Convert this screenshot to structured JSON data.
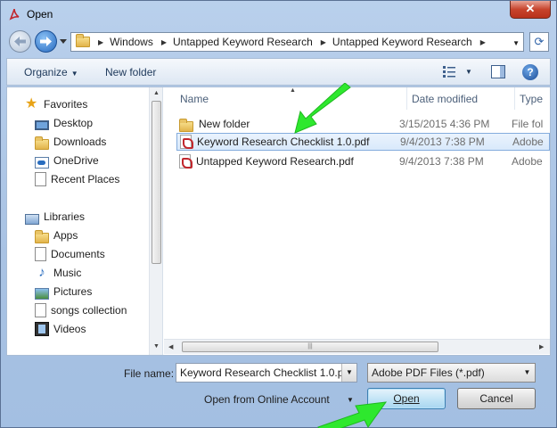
{
  "window": {
    "title": "Open",
    "close_label": "✕"
  },
  "address": {
    "crumbs": [
      "Windows",
      "Untapped Keyword Research",
      "Untapped Keyword Research"
    ]
  },
  "toolbar": {
    "organize_label": "Organize",
    "new_folder_label": "New folder"
  },
  "nav_pane": {
    "favorites_label": "Favorites",
    "favorites": [
      {
        "label": "Desktop",
        "icon": "desktop-icon"
      },
      {
        "label": "Downloads",
        "icon": "downloads-icon"
      },
      {
        "label": "OneDrive",
        "icon": "onedrive-icon"
      },
      {
        "label": "Recent Places",
        "icon": "recent-places-icon"
      }
    ],
    "libraries_label": "Libraries",
    "libraries": [
      {
        "label": "Apps",
        "icon": "folder-icon"
      },
      {
        "label": "Documents",
        "icon": "documents-icon"
      },
      {
        "label": "Music",
        "icon": "music-icon"
      },
      {
        "label": "Pictures",
        "icon": "pictures-icon"
      },
      {
        "label": "songs collection",
        "icon": "library-icon"
      },
      {
        "label": "Videos",
        "icon": "videos-icon"
      }
    ]
  },
  "file_list": {
    "columns": [
      "Name",
      "Date modified",
      "Type"
    ],
    "rows": [
      {
        "name": "New folder",
        "date": "3/15/2015 4:36 PM",
        "type": "File fol",
        "icon": "folder-icon",
        "selected": false
      },
      {
        "name": "Keyword Research Checklist 1.0.pdf",
        "date": "9/4/2013 7:38 PM",
        "type": "Adobe",
        "icon": "pdf-icon",
        "selected": true
      },
      {
        "name": "Untapped Keyword Research.pdf",
        "date": "9/4/2013 7:38 PM",
        "type": "Adobe",
        "icon": "pdf-icon",
        "selected": false
      }
    ]
  },
  "bottom": {
    "file_name_label": "File name:",
    "file_name_value": "Keyword Research Checklist 1.0.pc",
    "filter_value": "Adobe PDF Files (*.pdf)",
    "online_label": "Open from Online Account",
    "open_label": "Open",
    "cancel_label": "Cancel"
  },
  "colors": {
    "arrow": "#2ee82e",
    "accent": "#3c7fb1"
  }
}
